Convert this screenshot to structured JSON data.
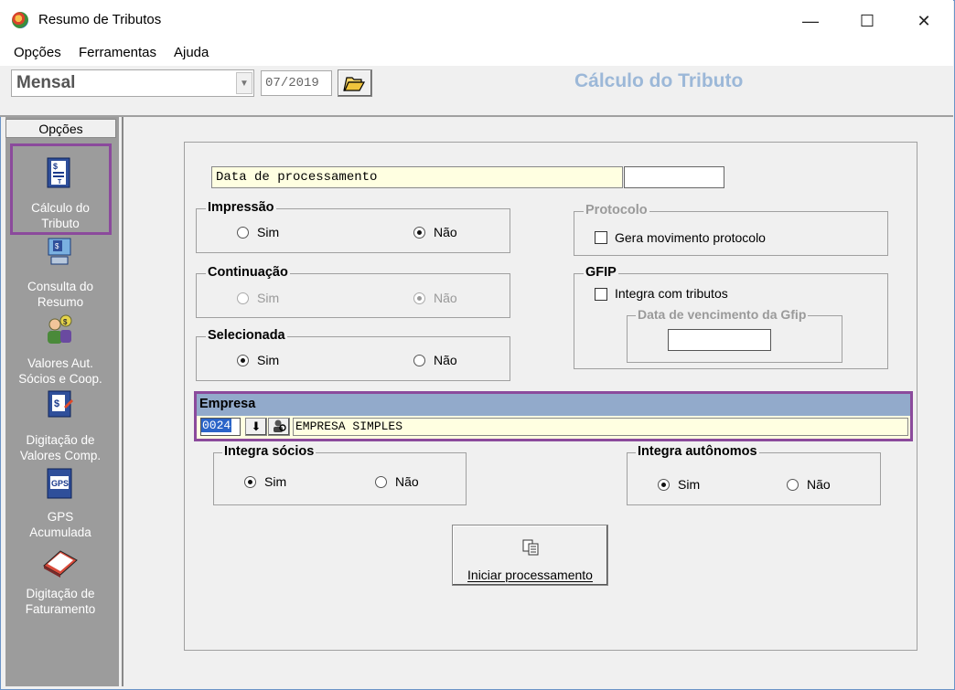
{
  "window": {
    "title": "Resumo de Tributos",
    "minimize": "—",
    "maximize": "☐",
    "close": "✕"
  },
  "menu": {
    "items": [
      "Opções",
      "Ferramentas",
      "Ajuda"
    ]
  },
  "toolbar": {
    "period": "Mensal",
    "month": "07/2019",
    "page_title": "Cálculo do Tributo"
  },
  "sidebar": {
    "header": "Opções",
    "items": [
      {
        "line1": "Cálculo do",
        "line2": "Tributo",
        "icon": "tax-calc-icon",
        "selected": true
      },
      {
        "line1": "Consulta do",
        "line2": "Resumo",
        "icon": "computer-summary-icon"
      },
      {
        "line1": "Valores Aut.",
        "line2": "Sócios e  Coop.",
        "icon": "partners-values-icon"
      },
      {
        "line1": "Digitação de",
        "line2": "Valores Comp.",
        "icon": "values-entry-icon"
      },
      {
        "line1": "GPS",
        "line2": "Acumulada",
        "icon": "gps-doc-icon",
        "badge": "GPS"
      },
      {
        "line1": "Digitação de",
        "line2": "Faturamento",
        "icon": "billing-book-icon"
      }
    ]
  },
  "form": {
    "date_label": "Data de processamento",
    "date_value": "",
    "impressao": {
      "title": "Impressão",
      "sim": "Sim",
      "nao": "Não",
      "selected": "nao"
    },
    "continuacao": {
      "title": "Continuação",
      "sim": "Sim",
      "nao": "Não",
      "selected": "nao",
      "disabled": true
    },
    "selecionada": {
      "title": "Selecionada",
      "sim": "Sim",
      "nao": "Não",
      "selected": "sim"
    },
    "protocolo": {
      "title": "Protocolo",
      "checkbox": "Gera movimento protocolo",
      "checked": false
    },
    "gfip": {
      "title": "GFIP",
      "checkbox": "Integra com tributos",
      "checked": false,
      "due_title": "Data de vencimento da Gfip",
      "due_value": ""
    },
    "empresa": {
      "title": "Empresa",
      "code": "0024",
      "name": "EMPRESA SIMPLES"
    },
    "integra_socios": {
      "title": "Integra sócios",
      "sim": "Sim",
      "nao": "Não",
      "selected": "sim"
    },
    "integra_autonomos": {
      "title": "Integra autônomos",
      "sim": "Sim",
      "nao": "Não",
      "selected": "sim"
    },
    "start_button": "Iniciar processamento"
  },
  "colors": {
    "accent_frame": "#8b4a9c",
    "title_blue": "#9cb8d8",
    "empresa_header": "#92aacb",
    "field_yellow": "#ffffe1"
  }
}
